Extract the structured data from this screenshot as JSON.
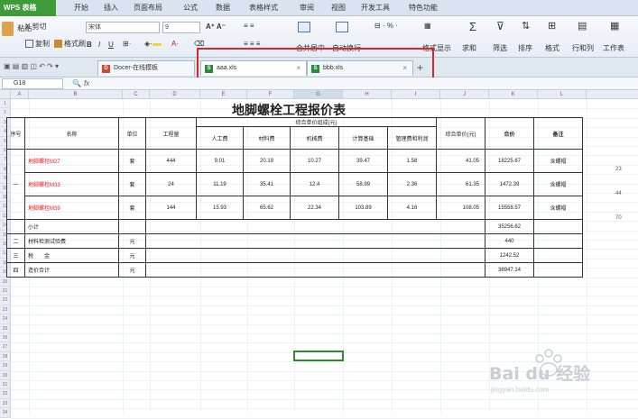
{
  "app": {
    "title": "WPS 表格"
  },
  "menu": [
    "开始",
    "插入",
    "页面布局",
    "公式",
    "数据",
    "表格样式",
    "审阅",
    "视图",
    "开发工具",
    "特色功能"
  ],
  "ribbon": {
    "paste": "粘贴",
    "cut": "X 剪切",
    "copy": "复制",
    "format_painter": "格式刷",
    "font_name": "宋体",
    "font_size": "9",
    "merge": "合并居中",
    "wrap": "自动换行",
    "number_format": "%",
    "cond_format": "格式显示",
    "sum": "求和",
    "filter": "筛选",
    "sort": "排序",
    "format": "格式",
    "rowcol": "行和列",
    "worksheet": "工作表"
  },
  "tabs": [
    {
      "label": "Docer-在线模板"
    },
    {
      "label": "aaa.xls"
    },
    {
      "label": "bbb.xls"
    }
  ],
  "new_tab": "+",
  "formula": {
    "cell_ref": "G18",
    "fx": "fx"
  },
  "columns": [
    "A",
    "B",
    "C",
    "D",
    "E",
    "F",
    "G",
    "H",
    "I",
    "J",
    "K",
    "L"
  ],
  "rows": [
    "1",
    "2",
    "3",
    "4",
    "5",
    "6",
    "7",
    "8",
    "9",
    "10",
    "11",
    "12",
    "13",
    "14",
    "15",
    "16",
    "17",
    "18",
    "19",
    "20",
    "21",
    "22",
    "23",
    "24",
    "25",
    "26",
    "27",
    "28",
    "29",
    "30",
    "31",
    "32",
    "33",
    "34"
  ],
  "sheet": {
    "title": "地脚螺栓工程报价表",
    "headers": {
      "seq": "序号",
      "name": "名称",
      "unit": "单位",
      "qty": "工程量",
      "group": "综合单价组成(元)",
      "labor": "人工费",
      "material": "材料费",
      "machine": "机械费",
      "base": "计算基础",
      "mgmt": "管理费和利润",
      "unit_price": "综合单价(元)",
      "total": "合价",
      "remark": "备注"
    },
    "items": [
      {
        "seq": "",
        "name": "地脚螺栓M27",
        "unit": "套",
        "qty": "444",
        "labor": "9.01",
        "material": "20.19",
        "machine": "10.27",
        "base": "39.47",
        "mgmt": "1.58",
        "unit_price": "41.05",
        "total": "18225.67",
        "remark": "含螺帽"
      },
      {
        "seq": "一",
        "name": "地脚螺栓M33",
        "unit": "套",
        "qty": "24",
        "labor": "11.19",
        "material": "35.41",
        "machine": "12.4",
        "base": "58.99",
        "mgmt": "2.36",
        "unit_price": "61.35",
        "total": "1472.39",
        "remark": "含螺帽"
      },
      {
        "seq": "",
        "name": "地脚螺栓M39",
        "unit": "套",
        "qty": "144",
        "labor": "15.93",
        "material": "65.62",
        "machine": "22.34",
        "base": "103.89",
        "mgmt": "4.16",
        "unit_price": "108.05",
        "total": "15558.57",
        "remark": "含螺帽"
      }
    ],
    "subtotal": {
      "label": "小计",
      "total": "35256.62"
    },
    "extra": [
      {
        "seq": "二",
        "name": "材料检测试验费",
        "unit": "元",
        "total": "440"
      },
      {
        "seq": "三",
        "name": "税　　金",
        "unit": "元",
        "total": "1242.52"
      },
      {
        "seq": "四",
        "name": "造价合计",
        "unit": "元",
        "total": "36947.14"
      }
    ],
    "side_numbers": [
      "23",
      "44",
      "70"
    ]
  },
  "watermark": {
    "brand": "Bai du 经验",
    "url": "jingyan.baidu.com"
  }
}
